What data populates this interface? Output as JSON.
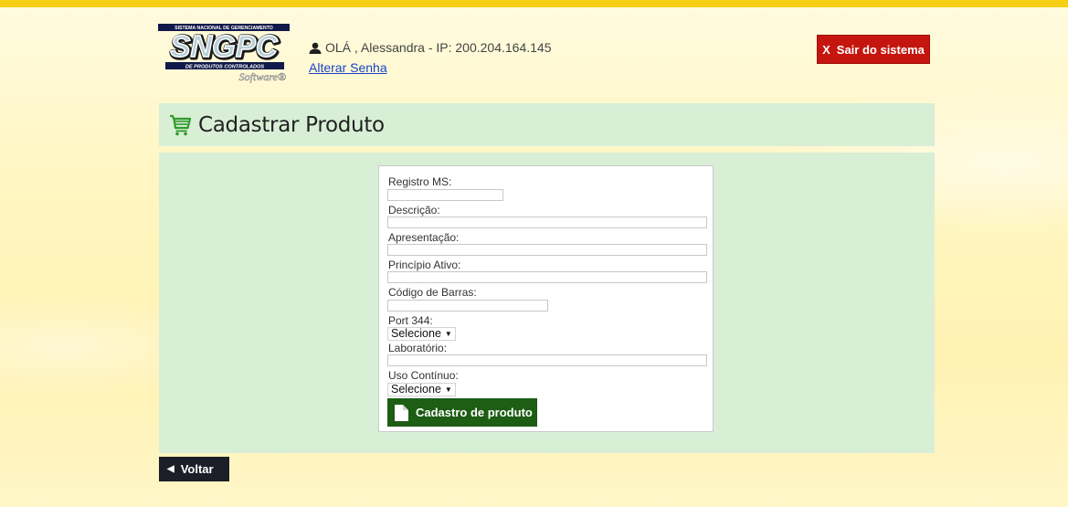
{
  "header": {
    "logo": {
      "top_text": "SISTEMA NACIONAL DE GERENCIAMENTO",
      "brand": "SNGPC",
      "bottom_text": "DE PRODUTOS CONTROLADOS",
      "tagline": "Software®"
    },
    "user_greeting": "OLÁ , Alessandra - IP: 200.204.164.145",
    "change_password_link": "Alterar Senha",
    "logout_label": "Sair do sistema",
    "logout_icon_text": "X"
  },
  "page_title": "Cadastrar Produto",
  "form": {
    "fields": {
      "registro_ms": {
        "label": "Registro MS:",
        "value": ""
      },
      "descricao": {
        "label": "Descrição:",
        "value": ""
      },
      "apresentacao": {
        "label": "Apresentação:",
        "value": ""
      },
      "principio_ativo": {
        "label": "Princípio Ativo:",
        "value": ""
      },
      "codigo_barras": {
        "label": "Código de Barras:",
        "value": ""
      },
      "port_344": {
        "label": "Port 344:",
        "selected": "Selecione"
      },
      "laboratorio": {
        "label": "Laboratório:",
        "value": ""
      },
      "uso_continuo": {
        "label": "Uso Contínuo:",
        "selected": "Selecione"
      }
    },
    "submit_label": "Cadastro de produto"
  },
  "back_label": "Voltar",
  "colors": {
    "accent_green": "#1d5d14",
    "panel_green": "#d8efd6",
    "logout_red": "#c4160f",
    "top_stripe": "#f7cf14",
    "back_dark": "#1c1f27"
  }
}
